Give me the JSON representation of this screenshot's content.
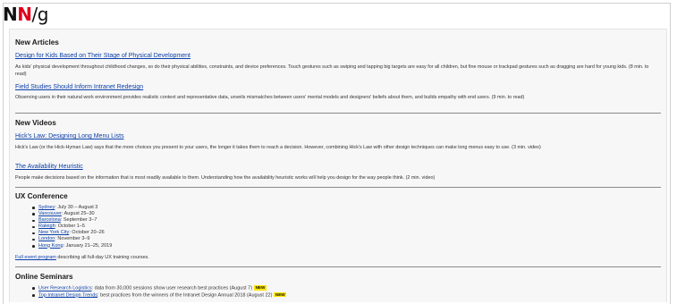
{
  "logo": {
    "n1": "N",
    "n2": "N",
    "slash": "/",
    "g": "g"
  },
  "articles": {
    "heading": "New Articles",
    "items": [
      {
        "title": "Design for Kids Based on Their Stage of Physical Development",
        "desc": "As kids' physical development throughout childhood changes, so do their physical abilities, constraints, and device preferences. Touch gestures such as swiping and tapping big targets are easy for all children, but fine mouse or trackpad gestures such as dragging are hard for young kids. (8 min. to read)"
      },
      {
        "title": "Field Studies Should Inform Intranet Redesign",
        "desc": "Observing users in their natural work environment provides realistic context and representative data, unveils mismatches between users' mental models and designers' beliefs about them, and builds empathy with end users. (9 min. to read)"
      }
    ]
  },
  "videos": {
    "heading": "New Videos",
    "items": [
      {
        "title": "Hick's Law: Designing Long Menu Lists",
        "desc": "Hick's Law (or the Hick-Hyman Law) says that the more choices you present to your users, the longer it takes them to reach a decision. However, combining Hick's Law with other design techniques can make long menus easy to use. (3 min. video)"
      },
      {
        "title": "The Availability Heuristic",
        "desc": "People make decisions based on the information that is most readily available to them. Understanding how the availability heuristic works will help you design for the way people think. (2 min. video)"
      }
    ]
  },
  "conference": {
    "heading": "UX Conference",
    "events": [
      {
        "city": "Sydney",
        "dates": ": July 30 – August 3"
      },
      {
        "city": "Vancouver",
        "dates": ": August 25–30"
      },
      {
        "city": "Barcelona",
        "dates": ": September 3–7"
      },
      {
        "city": "Raleigh",
        "dates": ": October 1–5"
      },
      {
        "city": "New York City",
        "dates": ": October 20–26"
      },
      {
        "city": "London",
        "dates": ": November 3–9"
      },
      {
        "city": "Hong Kong",
        "dates": ": January 21–25, 2019"
      }
    ],
    "program_link": "Full event program",
    "program_suffix": " describing all full-day UX training courses."
  },
  "seminars": {
    "heading": "Online Seminars",
    "items": [
      {
        "title": "User Research Logistics",
        "desc": ": data from 30,000 sessions show user research best practices (August 7)",
        "badge": "NEW"
      },
      {
        "title": "Top Intranet Design Trends",
        "desc": ": best practices from the winners of the Intranet Design Annual 2018 (August 22)",
        "badge": "NEW"
      }
    ]
  },
  "colors": {
    "link": "#0b3fa8",
    "logo_accent": "#e0001b",
    "new_badge": "#ffe600"
  }
}
